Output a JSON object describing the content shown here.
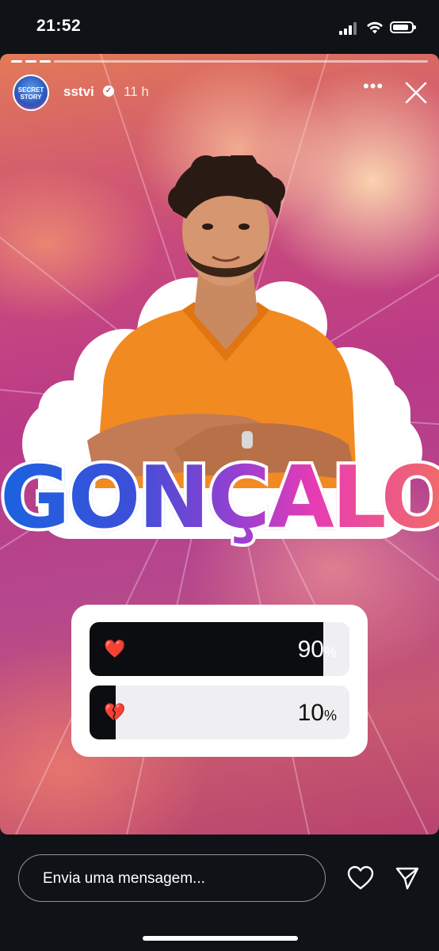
{
  "status_bar": {
    "time": "21:52"
  },
  "story": {
    "username": "sstvi",
    "time_ago": "11 h",
    "avatar_text": "SECRET STORY",
    "title": "GONÇALO",
    "poll": {
      "options": [
        {
          "emoji": "❤️",
          "percent": 90,
          "percent_label": "90",
          "percent_sign": "%"
        },
        {
          "emoji": "💔",
          "percent": 10,
          "percent_label": "10",
          "percent_sign": "%"
        }
      ]
    }
  },
  "reply_bar": {
    "placeholder": "Envia uma mensagem..."
  },
  "colors": {
    "accent": "#c94a7c",
    "poll_fill": "#0b0d10"
  },
  "icons": [
    "verified-icon",
    "more-icon",
    "close-icon",
    "heart-icon",
    "send-icon"
  ]
}
